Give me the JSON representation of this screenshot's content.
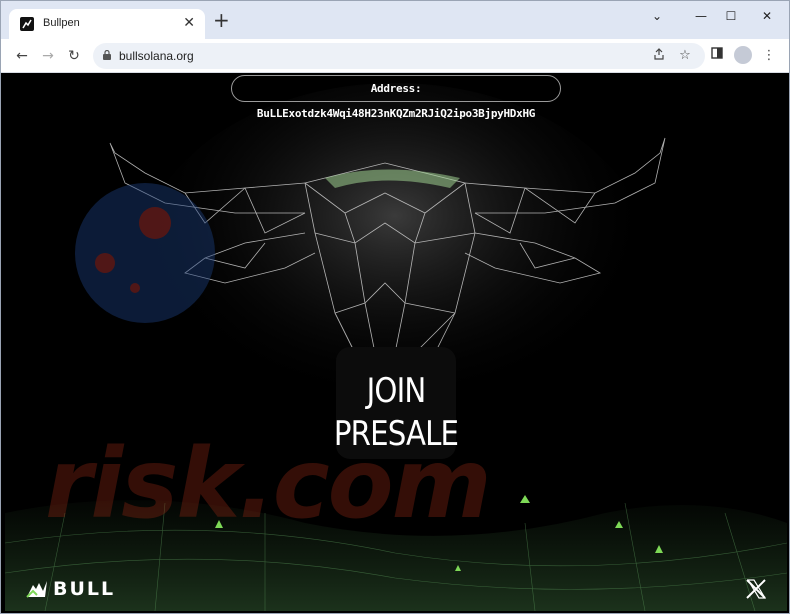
{
  "browser": {
    "tab_title": "Bullpen",
    "tab_close": "✕",
    "new_tab": "+",
    "url": "bullsolana.org",
    "window_controls": {
      "minimize": "⌄",
      "restore": "—",
      "maximize": "☐",
      "close": "✕"
    },
    "nav": {
      "back": "←",
      "forward": "→",
      "reload": "↻"
    },
    "icons": {
      "share": "share-icon",
      "bookmark": "star-icon",
      "side_panel": "side-panel-icon",
      "menu": "kebab-menu-icon"
    }
  },
  "page": {
    "address_label": "Address: BuLLExotdzk4Wqi48H23nKQZm2RJiQ2ipo3BjpyHDxHG",
    "join_line1": "JOIN",
    "join_line2": "PRESALE",
    "logo_text": "BULL",
    "watermark": "risk.com",
    "accent_color": "#7ed957"
  }
}
